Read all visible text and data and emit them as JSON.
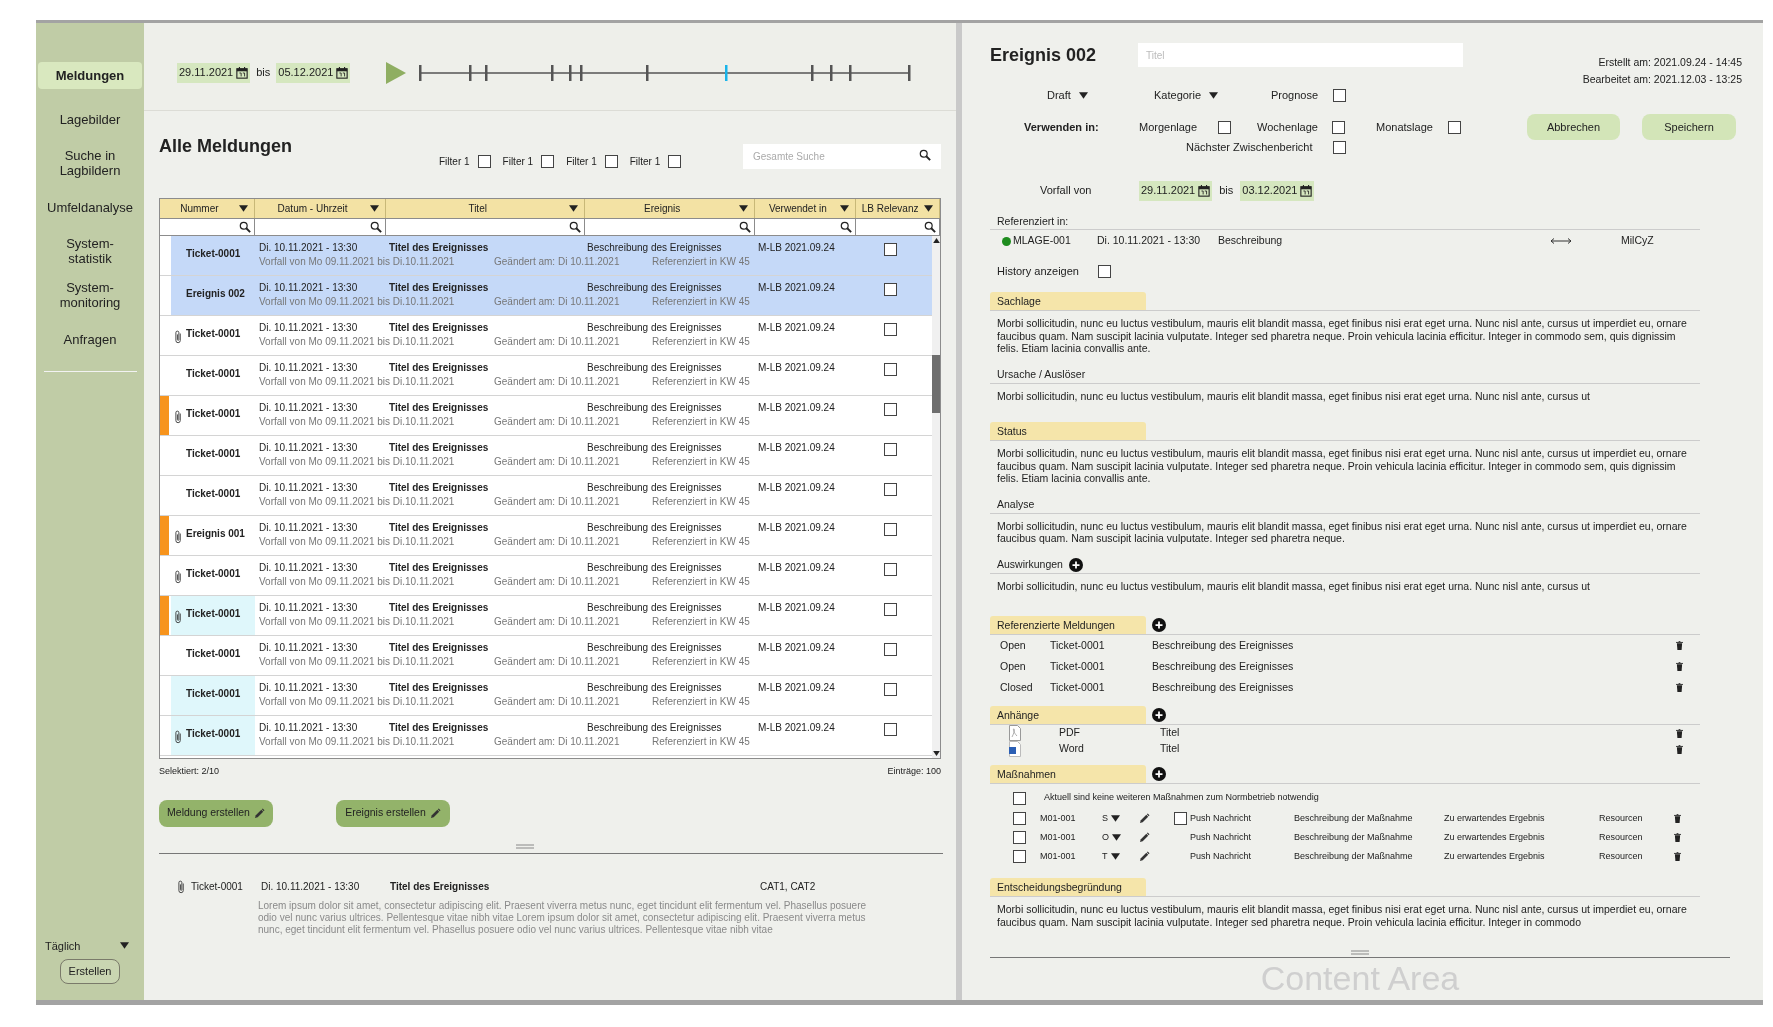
{
  "sidebar": {
    "items": [
      {
        "label": "Meldungen",
        "selected": true
      },
      {
        "label": "Lagebilder",
        "selected": false
      },
      {
        "label": "Suche in\nLagbildern",
        "selected": false
      },
      {
        "label": "Umfeldanalyse",
        "selected": false
      },
      {
        "label": "System-\nstatistik",
        "selected": false
      },
      {
        "label": "System-\nmonitoring",
        "selected": false
      },
      {
        "label": "Anfragen",
        "selected": false
      }
    ],
    "interval": "Täglich",
    "create_button": "Erstellen"
  },
  "timeline": {
    "from": "29.11.2021",
    "separator": "bis",
    "to": "05.12.2021",
    "ticks": [
      {
        "selected": false
      },
      {
        "selected": false
      },
      {
        "selected": false
      },
      {
        "selected": false
      },
      {
        "selected": false
      },
      {
        "selected": false
      },
      {
        "selected": false
      },
      {
        "selected": true
      },
      {
        "selected": false
      },
      {
        "selected": false
      },
      {
        "selected": false
      },
      {
        "selected": false
      }
    ]
  },
  "list": {
    "title": "Alle Meldungen",
    "filters": [
      {
        "label": "Filter 1",
        "checked": false
      },
      {
        "label": "Filter 1",
        "checked": false
      },
      {
        "label": "Filter 1",
        "checked": false
      },
      {
        "label": "Filter 1",
        "checked": false
      }
    ],
    "search": {
      "placeholder": "Gesamte Suche"
    },
    "columns": [
      "Nummer",
      "Datum - Uhrzeit",
      "Titel",
      "Ereignis",
      "Verwendet in",
      "LB Relevanz"
    ],
    "rows": [
      {
        "number": "Ticket-0001",
        "date": "Di. 10.11.2021 - 13:30",
        "title": "Titel des Ereignisses",
        "event": "Beschreibung des Ereignisses",
        "used_in": "M-LB 2021.09.24",
        "period": "Vorfall von Mo 09.11.2021 bis Di.10.11.2021",
        "changed": "Geändert am: Di 10.11.2021",
        "referenced": "Referenziert in KW 45",
        "selected": true,
        "flagged": false,
        "attachment": false,
        "highlighted": false,
        "lb_relevant": false
      },
      {
        "number": "Ereignis 002",
        "date": "Di. 10.11.2021 - 13:30",
        "title": "Titel des Ereignisses",
        "event": "Beschreibung des Ereignisses",
        "used_in": "M-LB 2021.09.24",
        "period": "Vorfall von Mo 09.11.2021 bis Di.10.11.2021",
        "changed": "Geändert am: Di 10.11.2021",
        "referenced": "Referenziert in KW 45",
        "selected": true,
        "flagged": false,
        "attachment": false,
        "highlighted": false,
        "lb_relevant": false
      },
      {
        "number": "Ticket-0001",
        "date": "Di. 10.11.2021 - 13:30",
        "title": "Titel des Ereignisses",
        "event": "Beschreibung des Ereignisses",
        "used_in": "M-LB 2021.09.24",
        "period": "Vorfall von Mo 09.11.2021 bis Di.10.11.2021",
        "changed": "Geändert am: Di 10.11.2021",
        "referenced": "Referenziert in KW 45",
        "selected": false,
        "flagged": false,
        "attachment": true,
        "highlighted": false,
        "lb_relevant": false
      },
      {
        "number": "Ticket-0001",
        "date": "Di. 10.11.2021 - 13:30",
        "title": "Titel des Ereignisses",
        "event": "Beschreibung des Ereignisses",
        "used_in": "M-LB 2021.09.24",
        "period": "Vorfall von Mo 09.11.2021 bis Di.10.11.2021",
        "changed": "Geändert am: Di 10.11.2021",
        "referenced": "Referenziert in KW 45",
        "selected": false,
        "flagged": false,
        "attachment": false,
        "highlighted": false,
        "lb_relevant": false
      },
      {
        "number": "Ticket-0001",
        "date": "Di. 10.11.2021 - 13:30",
        "title": "Titel des Ereignisses",
        "event": "Beschreibung des Ereignisses",
        "used_in": "M-LB 2021.09.24",
        "period": "Vorfall von Mo 09.11.2021 bis Di.10.11.2021",
        "changed": "Geändert am: Di 10.11.2021",
        "referenced": "Referenziert in KW 45",
        "selected": false,
        "flagged": true,
        "attachment": true,
        "highlighted": false,
        "lb_relevant": false
      },
      {
        "number": "Ticket-0001",
        "date": "Di. 10.11.2021 - 13:30",
        "title": "Titel des Ereignisses",
        "event": "Beschreibung des Ereignisses",
        "used_in": "M-LB 2021.09.24",
        "period": "Vorfall von Mo 09.11.2021 bis Di.10.11.2021",
        "changed": "Geändert am: Di 10.11.2021",
        "referenced": "Referenziert in KW 45",
        "selected": false,
        "flagged": false,
        "attachment": false,
        "highlighted": false,
        "lb_relevant": false
      },
      {
        "number": "Ticket-0001",
        "date": "Di. 10.11.2021 - 13:30",
        "title": "Titel des Ereignisses",
        "event": "Beschreibung des Ereignisses",
        "used_in": "M-LB 2021.09.24",
        "period": "Vorfall von Mo 09.11.2021 bis Di.10.11.2021",
        "changed": "Geändert am: Di 10.11.2021",
        "referenced": "Referenziert in KW 45",
        "selected": false,
        "flagged": false,
        "attachment": false,
        "highlighted": false,
        "lb_relevant": false
      },
      {
        "number": "Ereignis 001",
        "date": "Di. 10.11.2021 - 13:30",
        "title": "Titel des Ereignisses",
        "event": "Beschreibung des Ereignisses",
        "used_in": "M-LB 2021.09.24",
        "period": "Vorfall von Mo 09.11.2021 bis Di.10.11.2021",
        "changed": "Geändert am: Di 10.11.2021",
        "referenced": "Referenziert in KW 45",
        "selected": false,
        "flagged": true,
        "attachment": true,
        "highlighted": false,
        "lb_relevant": false
      },
      {
        "number": "Ticket-0001",
        "date": "Di. 10.11.2021 - 13:30",
        "title": "Titel des Ereignisses",
        "event": "Beschreibung des Ereignisses",
        "used_in": "M-LB 2021.09.24",
        "period": "Vorfall von Mo 09.11.2021 bis Di.10.11.2021",
        "changed": "Geändert am: Di 10.11.2021",
        "referenced": "Referenziert in KW 45",
        "selected": false,
        "flagged": false,
        "attachment": true,
        "highlighted": false,
        "lb_relevant": false
      },
      {
        "number": "Ticket-0001",
        "date": "Di. 10.11.2021 - 13:30",
        "title": "Titel des Ereignisses",
        "event": "Beschreibung des Ereignisses",
        "used_in": "M-LB 2021.09.24",
        "period": "Vorfall von Mo 09.11.2021 bis Di.10.11.2021",
        "changed": "Geändert am: Di 10.11.2021",
        "referenced": "Referenziert in KW 45",
        "selected": false,
        "flagged": true,
        "attachment": true,
        "highlighted": true,
        "lb_relevant": false
      },
      {
        "number": "Ticket-0001",
        "date": "Di. 10.11.2021 - 13:30",
        "title": "Titel des Ereignisses",
        "event": "Beschreibung des Ereignisses",
        "used_in": "M-LB 2021.09.24",
        "period": "Vorfall von Mo 09.11.2021 bis Di.10.11.2021",
        "changed": "Geändert am: Di 10.11.2021",
        "referenced": "Referenziert in KW 45",
        "selected": false,
        "flagged": false,
        "attachment": false,
        "highlighted": false,
        "lb_relevant": false
      },
      {
        "number": "Ticket-0001",
        "date": "Di. 10.11.2021 - 13:30",
        "title": "Titel des Ereignisses",
        "event": "Beschreibung des Ereignisses",
        "used_in": "M-LB 2021.09.24",
        "period": "Vorfall von Mo 09.11.2021 bis Di.10.11.2021",
        "changed": "Geändert am: Di 10.11.2021",
        "referenced": "Referenziert in KW 45",
        "selected": false,
        "flagged": false,
        "attachment": false,
        "highlighted": true,
        "lb_relevant": false
      },
      {
        "number": "Ticket-0001",
        "date": "Di. 10.11.2021 - 13:30",
        "title": "Titel des Ereignisses",
        "event": "Beschreibung des Ereignisses",
        "used_in": "M-LB 2021.09.24",
        "period": "Vorfall von Mo 09.11.2021 bis Di.10.11.2021",
        "changed": "Geändert am: Di 10.11.2021",
        "referenced": "Referenziert in KW 45",
        "selected": false,
        "flagged": false,
        "attachment": true,
        "highlighted": true,
        "lb_relevant": false
      }
    ],
    "selected_count": "Selektiert: 2/10",
    "entries": "Einträge: 100"
  },
  "actions": [
    "Meldung erstellen",
    "Ereignis erstellen"
  ],
  "preview": {
    "attachment": true,
    "number": "Ticket-0001",
    "date": "Di. 10.11.2021 - 13:30",
    "title": "Titel des Ereignisses",
    "categories": "CAT1, CAT2",
    "text": "Lorem ipsum dolor sit amet, consectetur adipiscing elit. Praesent viverra metus nunc, eget tincidunt elit fermentum vel. Phasellus posuere odio vel nunc varius ultrices. Pellentesque vitae nibh vitae Lorem ipsum dolor sit amet, consectetur adipiscing elit. Praesent viverra metus nunc, eget tincidunt elit fermentum vel. Phasellus posuere odio vel nunc varius ultrices. Pellentesque vitae nibh vitae"
  },
  "detail": {
    "title": "Ereignis 002",
    "title_field": {
      "placeholder": "Titel"
    },
    "created": "Erstellt am: 2021.09.24 - 14:45",
    "edited": "Bearbeitet am: 2021.12.03 - 13:25",
    "status_dropdown": "Draft",
    "category_dropdown": "Kategorie",
    "forecast": {
      "label": "Prognose",
      "checked": false
    },
    "use_in_label": "Verwenden in:",
    "use_in": [
      {
        "label": "Morgenlage",
        "checked": false
      },
      {
        "label": "Wochenlage",
        "checked": false
      },
      {
        "label": "Monatslage",
        "checked": false
      },
      {
        "label": "Nächster Zwischenbericht",
        "checked": false
      }
    ],
    "buttons": [
      "Abbrechen",
      "Speichern"
    ],
    "period_label": "Vorfall von",
    "period_from": "29.11.2021",
    "period_separator": "bis",
    "period_to": "03.12.2021",
    "references_label": "Referenziert in:",
    "references": [
      {
        "color": "#1e8c1e",
        "id": "MLAGE-001",
        "date": "Di. 10.11.2021 - 13:30",
        "description": "Beschreibung",
        "target": "MilCyZ"
      }
    ],
    "history": {
      "label": "History anzeigen",
      "checked": false
    },
    "sections": [
      {
        "kind": "tab",
        "title": "Sachlage",
        "text": "Morbi sollicitudin, nunc eu luctus vestibulum, mauris elit blandit massa, eget finibus nisi erat eget urna. Nunc nisl ante, cursus ut imperdiet eu, ornare faucibus quam. Nam suscipit lacinia vulputate. Integer sed pharetra neque. Proin vehicula lacinia efficitur. Integer in commodo sem, quis dignissim felis. Etiam lacinia convallis ante."
      },
      {
        "kind": "label",
        "title": "Ursache / Auslöser",
        "text": "Morbi sollicitudin, nunc eu luctus vestibulum, mauris elit blandit massa, eget finibus nisi erat eget urna. Nunc nisl ante, cursus ut"
      },
      {
        "kind": "tab",
        "title": "Status",
        "text": "Morbi sollicitudin, nunc eu luctus vestibulum, mauris elit blandit massa, eget finibus nisi erat eget urna. Nunc nisl ante, cursus ut imperdiet eu, ornare faucibus quam. Nam suscipit lacinia vulputate. Integer sed pharetra neque. Proin vehicula lacinia efficitur. Integer in commodo sem, quis dignissim felis. Etiam lacinia convallis ante."
      },
      {
        "kind": "label",
        "title": "Analyse",
        "text": "Morbi sollicitudin, nunc eu luctus vestibulum, mauris elit blandit massa, eget finibus nisi erat eget urna. Nunc nisl ante, cursus ut imperdiet eu, ornare faucibus quam. Nam suscipit lacinia vulputate. Integer sed pharetra neque."
      },
      {
        "kind": "label-add",
        "title": "Auswirkungen",
        "text": "Morbi sollicitudin, nunc eu luctus vestibulum, mauris elit blandit massa, eget finibus nisi erat eget urna. Nunc nisl ante, cursus ut"
      }
    ],
    "referenced": {
      "title": "Referenzierte Meldungen",
      "items": [
        {
          "state": "Open",
          "number": "Ticket-0001",
          "description": "Beschreibung des Ereignisses"
        },
        {
          "state": "Open",
          "number": "Ticket-0001",
          "description": "Beschreibung des Ereignisses"
        },
        {
          "state": "Closed",
          "number": "Ticket-0001",
          "description": "Beschreibung des Ereignisses"
        }
      ]
    },
    "attachments": {
      "title": "Anhänge",
      "items": [
        {
          "kind": "pdf",
          "type": "PDF",
          "title": "Titel"
        },
        {
          "kind": "word",
          "type": "Word",
          "title": "Titel"
        }
      ]
    },
    "measures": {
      "title": "Maßnahmen",
      "none_option": {
        "label": "Aktuell sind keine weiteren Maßnahmen zum Normbetrieb notwendig",
        "checked": false
      },
      "items": [
        {
          "kind": "push-option",
          "checked": false,
          "id": "M01-001",
          "priority": "S",
          "push": "Push Nachricht",
          "description": "Beschreibung der Maßnahme",
          "expected": "Zu erwartendes Ergebnis",
          "resources": "Resourcen"
        },
        {
          "kind": "plain",
          "checked": false,
          "id": "M01-001",
          "priority": "O",
          "push": "Push Nachricht",
          "description": "Beschreibung der Maßnahme",
          "expected": "Zu erwartendes Ergebnis",
          "resources": "Resourcen"
        },
        {
          "kind": "plain",
          "checked": false,
          "id": "M01-001",
          "priority": "T",
          "push": "Push Nachricht",
          "description": "Beschreibung der Maßnahme",
          "expected": "Zu erwartendes Ergebnis",
          "resources": "Resourcen"
        }
      ]
    },
    "decision": {
      "title": "Entscheidungsbegründung",
      "text": "Morbi sollicitudin, nunc eu luctus vestibulum, mauris elit blandit massa, eget finibus nisi erat eget urna. Nunc nisl ante, cursus ut imperdiet eu, ornare faucibus quam. Nam suscipit lacinia vulputate. Integer sed pharetra neque. Proin vehicula lacinia efficitur. Integer in commodo"
    },
    "footer_label": "Content Area"
  }
}
